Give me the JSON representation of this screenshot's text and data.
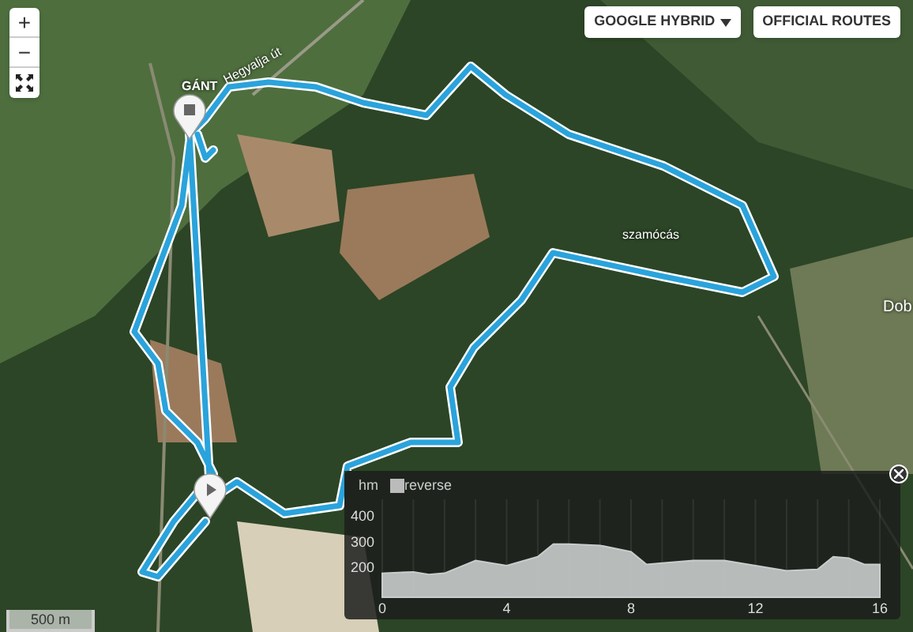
{
  "map": {
    "labels": [
      {
        "text": "GÁNT",
        "kind": "town"
      },
      {
        "text": "Hegyalja út",
        "kind": "road"
      },
      {
        "text": "szamócás",
        "kind": "place"
      },
      {
        "text": "Dob",
        "kind": "edge"
      }
    ],
    "scale": "500 m"
  },
  "zoom_controls": {
    "zoom_in": "+",
    "zoom_out": "−"
  },
  "layer_buttons": [
    {
      "label": "GOOGLE HYBRID",
      "dropdown": true
    },
    {
      "label": "OFFICIAL ROUTES",
      "dropdown": false
    }
  ],
  "elevation_panel": {
    "unit": "hm",
    "reverse": {
      "label": "reverse",
      "checked": false
    },
    "chart_data": {
      "type": "area",
      "x": [
        0,
        1,
        1.5,
        2,
        3,
        4,
        5,
        5.5,
        6,
        7,
        8,
        8.5,
        9,
        10,
        11,
        12,
        13,
        14,
        14.5,
        15,
        15.5,
        16
      ],
      "values": [
        175,
        180,
        170,
        175,
        225,
        205,
        240,
        290,
        290,
        285,
        260,
        210,
        215,
        225,
        225,
        205,
        185,
        190,
        240,
        235,
        210,
        210
      ],
      "xlim": [
        0,
        16
      ],
      "grid": true,
      "xticks": [
        0,
        4,
        8,
        12,
        {
          "value": 16,
          "label": "16"
        }
      ],
      "yticks": [
        200,
        300,
        400
      ],
      "ylim": [
        80,
        467
      ]
    }
  }
}
